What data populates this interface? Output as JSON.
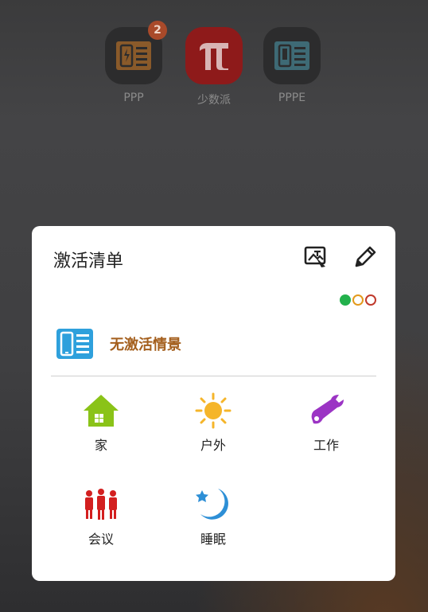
{
  "home_apps": [
    {
      "label": "PPP",
      "badge": "2",
      "icon": "phone-list-icon",
      "color": "#8a5a2a"
    },
    {
      "label": "少数派",
      "icon": "pi-icon",
      "color": "#8e1a1a"
    },
    {
      "label": "PPPE",
      "icon": "phone-list-icon",
      "color": "#3e6a75"
    }
  ],
  "card": {
    "title": "激活清单",
    "actions": [
      {
        "name": "image-edit-icon"
      },
      {
        "name": "pencil-icon"
      }
    ],
    "indicator_colors": [
      "#22b14c",
      "#e39a1c",
      "#c0392b"
    ],
    "status": {
      "icon": "phone-list-icon",
      "text": "无激活情景",
      "color": "#a45f1d"
    },
    "scenes": [
      {
        "label": "家",
        "icon": "house-icon",
        "color": "#8ac318"
      },
      {
        "label": "户外",
        "icon": "sun-icon",
        "color": "#f5b52a"
      },
      {
        "label": "工作",
        "icon": "wrench-icon",
        "color": "#9b34c4"
      },
      {
        "label": "会议",
        "icon": "people-icon",
        "color": "#d31f1f"
      },
      {
        "label": "睡眠",
        "icon": "moon-star-icon",
        "color": "#2d8fd6"
      }
    ]
  }
}
